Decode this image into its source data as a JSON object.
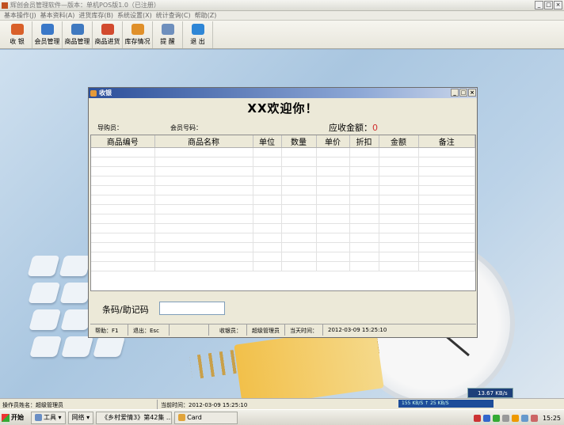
{
  "app": {
    "title": "辉创会员管理软件—版本：单机POS版1.0（已注册）",
    "window_controls": [
      "_",
      "□",
      "×"
    ]
  },
  "menubar": [
    "基本操作(J)",
    "基本资料(A)",
    "进货库存(B)",
    "系统设置(X)",
    "统计查询(C)",
    "帮助(Z)"
  ],
  "toolbar": [
    {
      "label": "收 银",
      "icon": "cashier-icon",
      "color": "#d9602a"
    },
    {
      "label": "会员管理",
      "icon": "members-icon",
      "color": "#3a78c8"
    },
    {
      "label": "商品管理",
      "icon": "products-icon",
      "color": "#3f79c0"
    },
    {
      "label": "商品进货",
      "icon": "purchase-icon",
      "color": "#d24a2e"
    },
    {
      "label": "库存情况",
      "icon": "inventory-icon",
      "color": "#e0902a"
    },
    {
      "label": "提 醒",
      "icon": "reminder-icon",
      "color": "#6e8fbd"
    },
    {
      "label": "退 出",
      "icon": "exit-icon",
      "color": "#2e86d6"
    }
  ],
  "dialog": {
    "title": "收银",
    "controls": [
      "_",
      "□",
      "×"
    ],
    "welcome": "XX欢迎你！",
    "guide_label": "导购员：",
    "member_label": "会员号码：",
    "amount_label": "应收金额：",
    "amount_value": "0",
    "columns": [
      "商品编号",
      "商品名称",
      "单位",
      "数量",
      "单价",
      "折扣",
      "金额",
      "备注"
    ],
    "barcode_label": "条码/助记码",
    "barcode_value": "",
    "status": {
      "help": "帮助：F1",
      "exit": "退出：Esc",
      "blank": "",
      "cashier_label": "收银员：",
      "cashier_name": "超级管理员",
      "time_label": "当天时间：",
      "time_value": "2012-03-09 15:25:10"
    }
  },
  "appstatus": {
    "operator": "操作员姓名：超级管理员",
    "time": "当前时间：2012-03-09 15:25:10"
  },
  "netrate": "13.67 KB/s",
  "trayrate": "155 KB/S ↑ 25 KB/S",
  "taskbar": {
    "start": "开始",
    "items": [
      "工具 ▾",
      "网络 ▾",
      "《乡村爱情3》第42集 ...",
      "Card"
    ],
    "time": "15:25"
  }
}
